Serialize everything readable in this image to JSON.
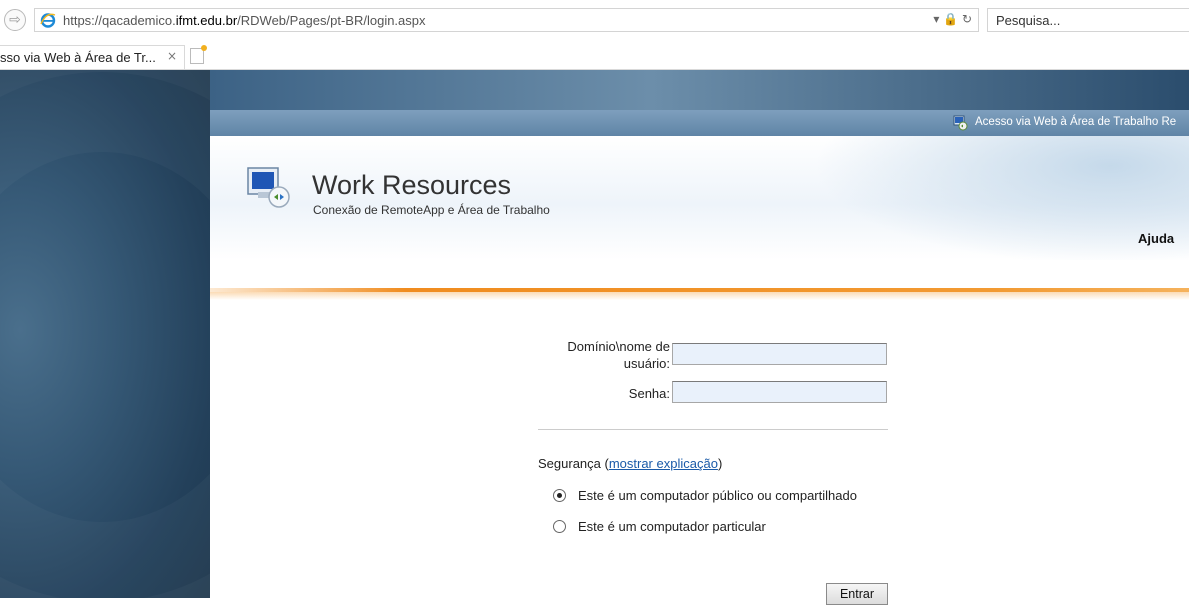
{
  "browser": {
    "url_prefix": "https://qacademico.",
    "url_domain": "ifmt.edu.br",
    "url_path": "/RDWeb/Pages/pt-BR/login.aspx",
    "url_icons": "▾ 🔒 ↻",
    "search_placeholder": "Pesquisa...",
    "tab_title": "sso via Web à Área de Tr...",
    "tab_close": "×"
  },
  "topbar": {
    "rdweb_link": "Acesso via Web à Área de Trabalho Re"
  },
  "header": {
    "title": "Work Resources",
    "subtitle": "Conexão de RemoteApp e Área de Trabalho",
    "help": "Ajuda"
  },
  "form": {
    "user_label_line1": "Domínio\\nome de",
    "user_label_line2": "usuário:",
    "password_label": "Senha:",
    "security_label": "Segurança (",
    "security_link": "mostrar explicação",
    "security_close": ")",
    "radio_public": "Este é um computador público ou compartilhado",
    "radio_private": "Este é um computador particular",
    "selected": "public",
    "submit": "Entrar"
  }
}
